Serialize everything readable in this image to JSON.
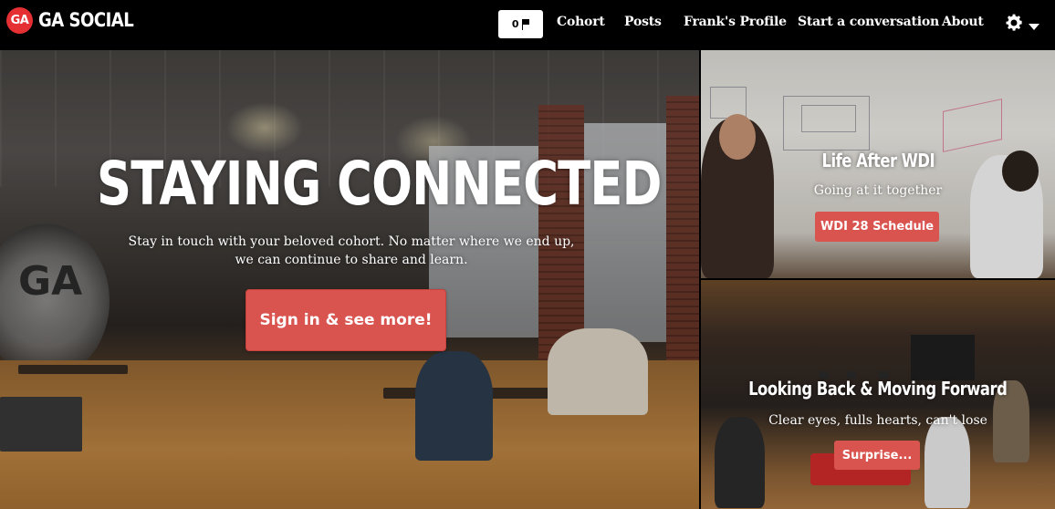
{
  "navbar": {
    "logo_text": "GA",
    "brand": "GA SOCIAL",
    "flag_count": "0",
    "links": [
      "Cohort",
      "Posts",
      "Frank's Profile",
      "Start a conversation",
      "About"
    ]
  },
  "hero": {
    "title": "STAYING CONNECTED",
    "subtitle": "Stay in touch with your beloved cohort. No matter where we end up, we can continue to share and learn.",
    "mural_text": "GA",
    "button_label": "Sign in & see more!"
  },
  "panels": [
    {
      "title": "Life After WDI",
      "subtitle": "Going at it together",
      "button_label": "WDI 28 Schedule"
    },
    {
      "title": "Looking Back & Moving Forward",
      "subtitle": "Clear eyes, fulls hearts, can't lose",
      "button_label": "Surprise..."
    }
  ],
  "icons": {
    "flag": "flag-icon",
    "settings": "gear-icon",
    "dropdown": "caret-down-icon"
  },
  "colors": {
    "brand_red": "#e42f33",
    "button_red": "#d9534f",
    "navbar": "#000000"
  }
}
